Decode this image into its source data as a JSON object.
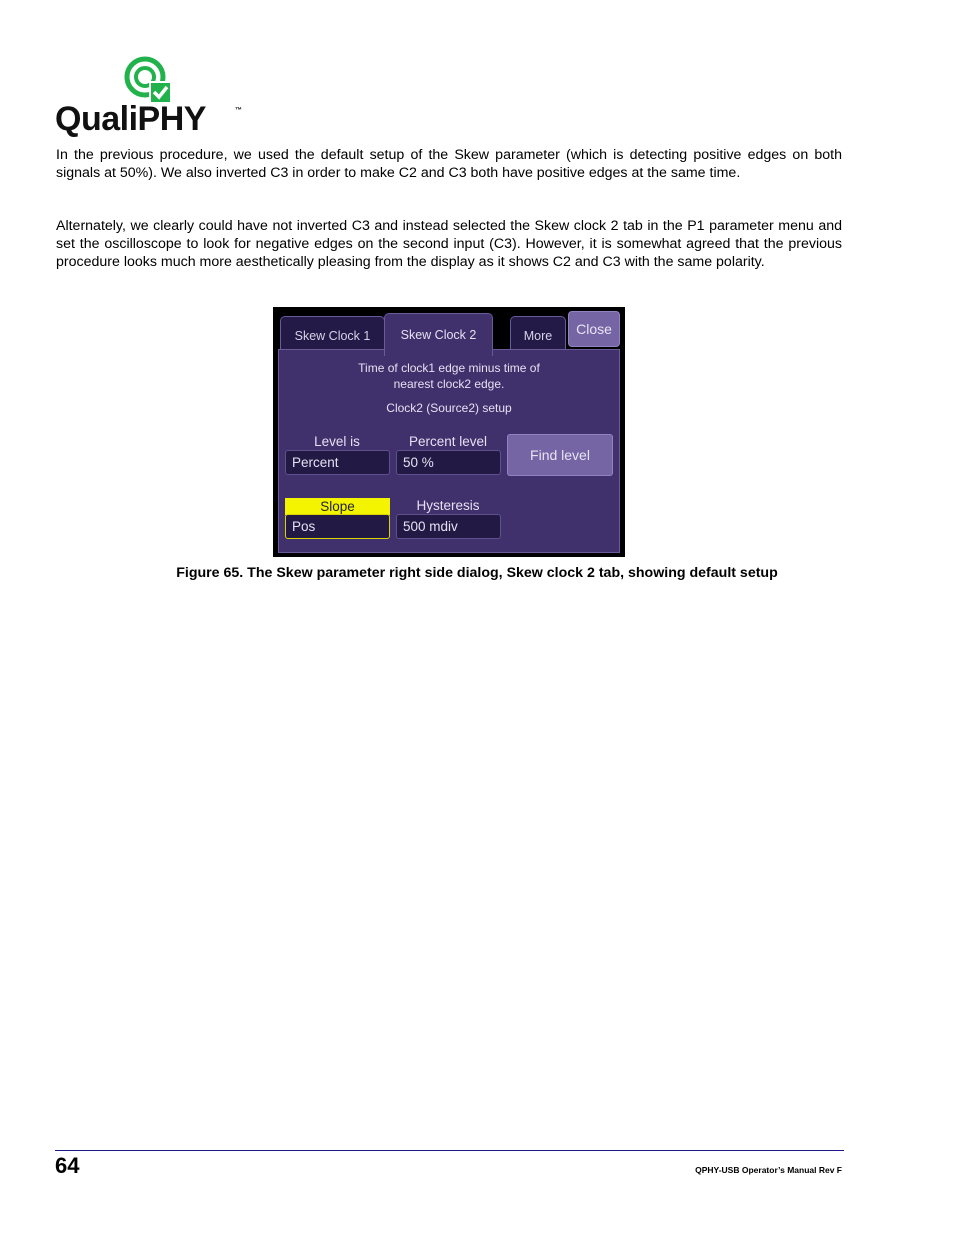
{
  "logo": {
    "text": "QualiPHY",
    "trademark": "™",
    "brand_color": "#22b24c",
    "icon": "qualiphy-check-logo-icon"
  },
  "paragraphs": [
    "In the previous procedure, we used the default setup of the Skew parameter (which is detecting positive edges on both signals at 50%). We also inverted C3 in order to make C2 and C3 both have positive edges at the same time.",
    "Alternately, we clearly could have not inverted C3 and instead selected the Skew clock 2 tab in the P1 parameter menu and set the oscilloscope to look for negative edges on the second input (C3). However, it is somewhat agreed that the previous procedure looks much more aesthetically pleasing from the display as it shows C2 and C3 with the same polarity."
  ],
  "dialog": {
    "tabs": [
      {
        "label": "Skew Clock 1",
        "active": false
      },
      {
        "label": "Skew Clock 2",
        "active": true
      },
      {
        "label": "More",
        "active": false
      }
    ],
    "close_label": "Close",
    "description_line1": "Time of clock1 edge minus time of",
    "description_line2": "nearest clock2 edge.",
    "section_title": "Clock2 (Source2) setup",
    "level_is": {
      "label": "Level is",
      "value": "Percent"
    },
    "percent_level": {
      "label": "Percent level",
      "value": "50 %"
    },
    "find_level_label": "Find level",
    "slope": {
      "label": "Slope",
      "value": "Pos",
      "highlight_color": "#f4f400"
    },
    "hysteresis": {
      "label": "Hysteresis",
      "value": "500 mdiv"
    },
    "colors": {
      "panel": "#40306c",
      "tab_inactive": "#241a48",
      "button": "#7565a5",
      "field": "#221a44"
    }
  },
  "caption": "Figure 65. The Skew parameter right side dialog, Skew clock 2 tab, showing default setup",
  "footer": {
    "page_number": "64",
    "manual_title": "QPHY-USB Operator’s Manual Rev F"
  }
}
